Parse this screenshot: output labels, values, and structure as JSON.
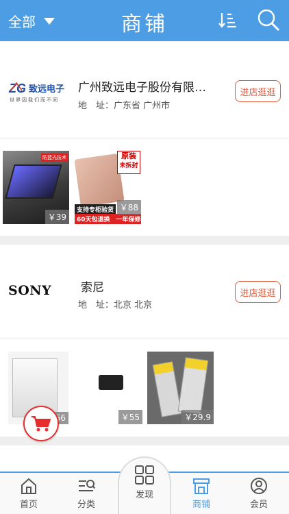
{
  "header": {
    "category_label": "全部",
    "title": "商铺"
  },
  "stores": [
    {
      "name": "广州致远电子股份有限…",
      "address": "地　址：广东省 广州市",
      "enter_label": "进店逛逛",
      "logo_text": "致远电子",
      "logo_slogan": "世界因我们而不同",
      "products": [
        {
          "price": "￥39",
          "sticker": "防蓝光技术"
        },
        {
          "price": "￥88",
          "sticker_top": "原装",
          "sticker_bottom": "未拆封",
          "banner1": "支持专柜验货",
          "banner2": "60天包退换　一年保修"
        }
      ]
    },
    {
      "name": "索尼",
      "address": "地　址：北京 北京",
      "enter_label": "进店逛逛",
      "logo_text": "SONY",
      "products": [
        {
          "price": "56"
        },
        {
          "price": "￥55"
        },
        {
          "price": "￥29.9"
        }
      ]
    }
  ],
  "tabbar": {
    "home": "首页",
    "category": "分类",
    "discover": "发现",
    "stores": "商铺",
    "member": "会员"
  },
  "colors": {
    "primary": "#4d9de5",
    "accent_red": "#e05a3a"
  }
}
